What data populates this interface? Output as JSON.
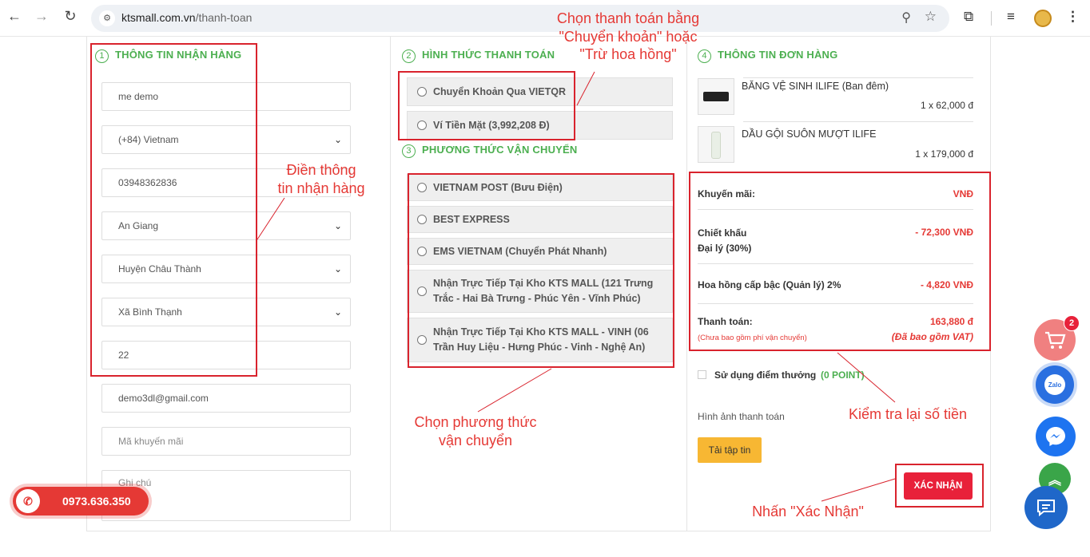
{
  "browser": {
    "url_domain": "ktsmall.com.vn",
    "url_path": "/thanh-toan",
    "back_icon": "←",
    "forward_icon": "→",
    "reload_icon": "↻"
  },
  "receiver": {
    "heading_num": "1",
    "heading": "THÔNG TIN NHẬN HÀNG",
    "name": "me demo",
    "country": "(+84) Vietnam",
    "phone": "03948362836",
    "province": "An Giang",
    "district": "Huyện Châu Thành",
    "ward": "Xã Bình Thạnh",
    "address": "22",
    "email": "demo3dl@gmail.com",
    "coupon_placeholder": "Mã khuyến mãi",
    "note_placeholder": "Ghi chú"
  },
  "payment": {
    "heading_num": "2",
    "heading": "HÌNH THỨC THANH TOÁN",
    "options": [
      "Chuyển Khoản Qua VIETQR",
      "Ví Tiền Mặt (3,992,208 Đ)"
    ]
  },
  "shipping": {
    "heading_num": "3",
    "heading": "PHƯƠNG THỨC VẬN CHUYỂN",
    "options": [
      "VIETNAM POST (Bưu Điện)",
      "BEST EXPRESS",
      "EMS VIETNAM (Chuyển Phát Nhanh)",
      "Nhận Trực Tiếp Tại Kho KTS MALL (121 Trưng Trắc - Hai Bà Trưng - Phúc Yên - Vĩnh Phúc)",
      "Nhận Trực Tiếp Tại Kho KTS MALL - VINH (06 Trần Huy Liệu - Hưng Phúc - Vinh - Nghệ An)"
    ]
  },
  "order": {
    "heading_num": "4",
    "heading": "THÔNG TIN ĐƠN HÀNG",
    "items": [
      {
        "name": "BĂNG VỆ SINH ILIFE (Ban đêm)",
        "qty": "1 x 62,000 đ"
      },
      {
        "name": "DẦU GỘI SUÔN MƯỢT ILIFE",
        "qty": "1 x 179,000 đ"
      }
    ],
    "promo_label": "Khuyến mãi:",
    "promo_value": "VNĐ",
    "discount_label_1": "Chiết khấu",
    "discount_label_2": "Đại lý (30%)",
    "discount_value": "- 72,300  VNĐ",
    "commission_label": "Hoa hồng cấp bậc (Quản lý) 2%",
    "commission_value": "- 4,820  VNĐ",
    "total_label": "Thanh toán:",
    "total_value": "163,880 đ",
    "total_note": "(Chưa bao gồm phí vận chuyển)",
    "vat_note": "(Đã bao gồm VAT)",
    "points_label": "Sử dụng điểm thưởng",
    "points_value": "(0 POINT)",
    "payment_image_label": "Hình ảnh thanh toán",
    "upload_button": "Tải tập tin",
    "confirm_button": "XÁC NHẬN"
  },
  "annotations": {
    "payment_1": "Chọn thanh toán bằng",
    "payment_2": "\"Chuyển khoản\" hoặc",
    "payment_3": "\"Trừ hoa hồng\"",
    "receiver_1": "Điền thông",
    "receiver_2": "tin nhận hàng",
    "shipping_1": "Chọn phương thức",
    "shipping_2": "vận chuyển",
    "check_total": "Kiểm tra lại số tiền",
    "press_confirm": "Nhấn \"Xác Nhận\""
  },
  "floating": {
    "hotline": "0973.636.350",
    "cart_badge": "2",
    "zalo_label": "Zalo"
  },
  "colors": {
    "accent_green": "#4caf50",
    "annotation_red": "#d9232d",
    "confirm_red": "#e8213a",
    "upload_yellow": "#f7b733"
  }
}
